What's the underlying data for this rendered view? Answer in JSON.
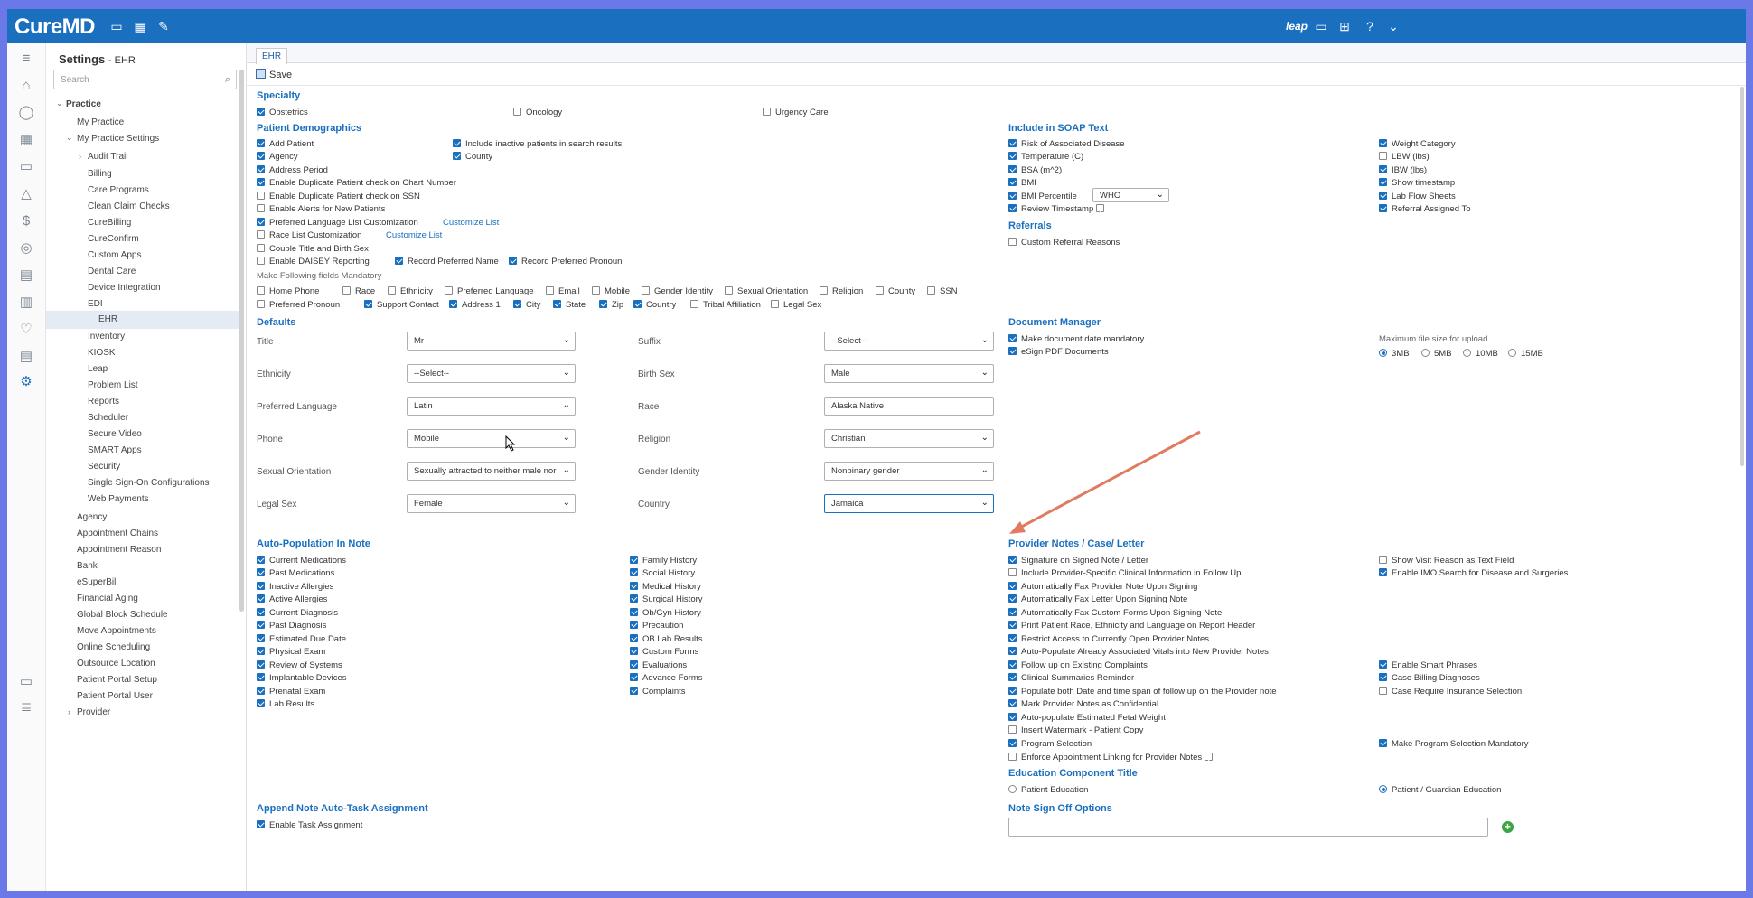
{
  "app": {
    "logo": "CureMD"
  },
  "topbar": {
    "right_logo": "leap"
  },
  "sidebar": {
    "title": "Settings",
    "subtitle": "- EHR",
    "search_placeholder": "Search",
    "items": {
      "practice": "Practice",
      "my_practice": "My Practice",
      "my_practice_settings": "My Practice Settings",
      "audit_trail": "Audit Trail",
      "billing": "Billing",
      "care_programs": "Care Programs",
      "clean_claim": "Clean Claim Checks",
      "curebilling": "CureBilling",
      "cureconfirm": "CureConfirm",
      "custom_apps": "Custom Apps",
      "dental_care": "Dental Care",
      "device_integration": "Device Integration",
      "edi": "EDI",
      "ehr": "EHR",
      "inventory": "Inventory",
      "kiosk": "KIOSK",
      "leap": "Leap",
      "problem_list": "Problem List",
      "reports": "Reports",
      "scheduler": "Scheduler",
      "secure_video": "Secure Video",
      "smart_apps": "SMART Apps",
      "security": "Security",
      "sso": "Single Sign-On Configurations",
      "web_payments": "Web Payments",
      "agency": "Agency",
      "appointment_chains": "Appointment Chains",
      "appointment_reason": "Appointment Reason",
      "bank": "Bank",
      "esuperbill": "eSuperBill",
      "financial_aging": "Financial Aging",
      "global_block": "Global Block Schedule",
      "move_appointments": "Move Appointments",
      "online_scheduling": "Online Scheduling",
      "outsource_location": "Outsource Location",
      "patient_portal_setup": "Patient Portal Setup",
      "patient_portal_user": "Patient Portal User",
      "provider": "Provider"
    }
  },
  "tab": "EHR",
  "save_label": "Save",
  "specialty": {
    "heading": "Specialty",
    "obstetrics": "Obstetrics",
    "oncology": "Oncology",
    "urgency": "Urgency Care"
  },
  "demo": {
    "heading": "Patient Demographics",
    "add_patient": "Add Patient",
    "agency": "Agency",
    "address_period": "Address Period",
    "dup_chart": "Enable Duplicate Patient check on Chart Number",
    "dup_ssn": "Enable Duplicate Patient check on SSN",
    "alerts": "Enable Alerts for New Patients",
    "pref_lang": "Preferred Language List Customization",
    "race_list": "Race List Customization",
    "couple": "Couple Title and Birth Sex",
    "daisey": "Enable DAISEY Reporting",
    "rec_name": "Record Preferred Name",
    "rec_pronoun": "Record Preferred Pronoun",
    "inactive": "Include inactive patients in search results",
    "county": "County",
    "customize": "Customize List",
    "mandatory_label": "Make Following fields Mandatory",
    "m_home_phone": "Home Phone",
    "m_race": "Race",
    "m_ethnicity": "Ethnicity",
    "m_pref_lang": "Preferred Language",
    "m_email": "Email",
    "m_mobile": "Mobile",
    "m_gender": "Gender Identity",
    "m_sexual": "Sexual Orientation",
    "m_religion": "Religion",
    "m_county": "County",
    "m_ssn": "SSN",
    "m_pronoun": "Preferred Pronoun",
    "m_support": "Support Contact",
    "m_address1": "Address 1",
    "m_city": "City",
    "m_state": "State",
    "m_zip": "Zip",
    "m_country": "Country",
    "m_tribal": "Tribal Affiliation",
    "m_legal_sex": "Legal Sex"
  },
  "soap": {
    "heading": "Include in SOAP Text",
    "risk": "Risk of Associated Disease",
    "temp": "Temperature (C)",
    "bsa": "BSA (m^2)",
    "bmi": "BMI",
    "bmi_pct": "BMI Percentile",
    "bmi_pct_value": "WHO",
    "review_ts": "Review Timestamp",
    "weight_cat": "Weight Category",
    "lbw": "LBW (lbs)",
    "ibw": "IBW (lbs)",
    "show_ts": "Show timestamp",
    "lab_flow": "Lab Flow Sheets",
    "referral_assigned": "Referral Assigned To"
  },
  "referrals": {
    "heading": "Referrals",
    "custom": "Custom Referral Reasons"
  },
  "defaults": {
    "heading": "Defaults",
    "title_l": "Title",
    "title_v": "Mr",
    "suffix_l": "Suffix",
    "suffix_v": "--Select--",
    "ethnicity_l": "Ethnicity",
    "ethnicity_v": "--Select--",
    "birthsex_l": "Birth Sex",
    "birthsex_v": "Male",
    "preflang_l": "Preferred Language",
    "preflang_v": "Latin",
    "race_l": "Race",
    "race_v": "Alaska Native",
    "phone_l": "Phone",
    "phone_v": "Mobile",
    "religion_l": "Religion",
    "religion_v": "Christian",
    "sexor_l": "Sexual Orientation",
    "sexor_v": "Sexually attracted to neither male nor",
    "gender_l": "Gender Identity",
    "gender_v": "Nonbinary gender",
    "legalsex_l": "Legal Sex",
    "legalsex_v": "Female",
    "country_l": "Country",
    "country_v": "Jamaica"
  },
  "docmgr": {
    "heading": "Document Manager",
    "date_mandatory": "Make document date mandatory",
    "esign": "eSign PDF Documents",
    "max_size": "Maximum file size for upload",
    "r3": "3MB",
    "r5": "5MB",
    "r10": "10MB",
    "r15": "15MB"
  },
  "autopop": {
    "heading": "Auto-Population In Note",
    "c1": [
      "Current Medications",
      "Past Medications",
      "Inactive Allergies",
      "Active Allergies",
      "Current Diagnosis",
      "Past Diagnosis",
      "Estimated Due Date",
      "Physical Exam",
      "Review of Systems",
      "Implantable Devices",
      "Prenatal Exam",
      "Lab Results"
    ],
    "c2": [
      "Family History",
      "Social History",
      "Medical History",
      "Surgical History",
      "Ob/Gyn History",
      "Precaution",
      "OB Lab Results",
      "Custom Forms",
      "Evaluations",
      "Advance Forms",
      "Complaints"
    ]
  },
  "provider_notes": {
    "heading": "Provider Notes / Case/ Letter",
    "items": [
      "Signature on Signed Note / Letter",
      "Include Provider-Specific Clinical Information in Follow Up",
      "Automatically Fax Provider Note Upon Signing",
      "Automatically Fax Letter Upon Signing Note",
      "Automatically Fax Custom Forms Upon Signing Note",
      "Print Patient Race, Ethnicity and Language on Report Header",
      "Restrict Access to Currently Open Provider Notes",
      "Auto-Populate Already Associated Vitals into New Provider Notes",
      "Follow up on Existing Complaints",
      "Clinical Summaries Reminder",
      "Populate both Date and time span of follow up on the Provider note",
      "Mark Provider Notes as Confidential",
      "Auto-populate Estimated Fetal Weight",
      "Insert Watermark - Patient Copy",
      "Program Selection",
      "Enforce Appointment Linking for Provider Notes"
    ],
    "right": {
      "show_visit": "Show Visit Reason as Text Field",
      "imo": "Enable IMO Search for Disease and Surgeries",
      "smart": "Enable Smart Phrases",
      "case_billing": "Case Billing Diagnoses",
      "case_ins": "Case Require Insurance Selection",
      "prog_mand": "Make Program Selection Mandatory"
    }
  },
  "education": {
    "heading": "Education Component Title",
    "patient": "Patient Education",
    "guardian": "Patient / Guardian Education"
  },
  "append": {
    "heading": "Append Note Auto-Task Assignment",
    "enable": "Enable Task Assignment"
  },
  "signoff": {
    "heading": "Note Sign Off Options"
  }
}
